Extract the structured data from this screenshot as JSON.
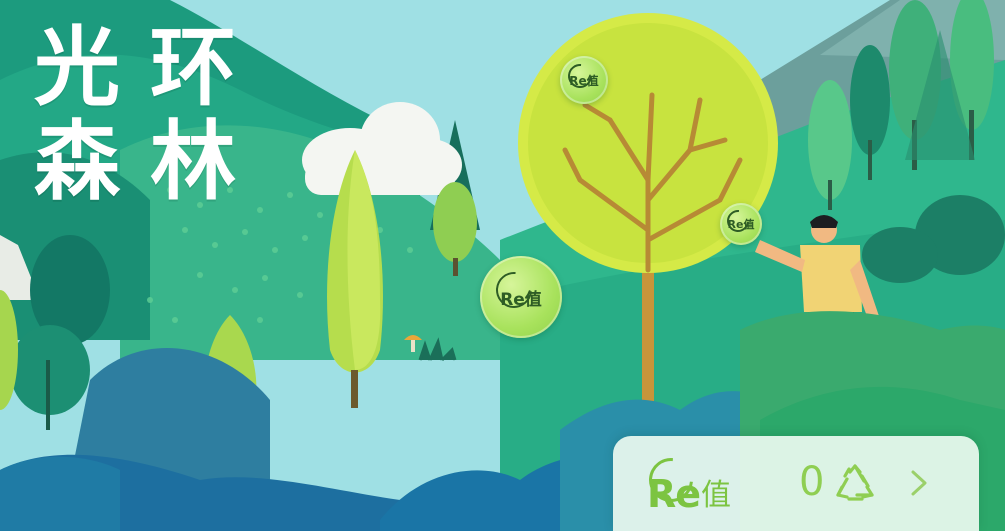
{
  "title": {
    "char1": "光",
    "char2": "环",
    "char3": "森",
    "char4": "林"
  },
  "bubbles": [
    {
      "label": "Re值"
    },
    {
      "label": "Re值"
    },
    {
      "label": "Re值"
    }
  ],
  "panel": {
    "re_text": "Re",
    "zhi_text": "值",
    "count": "0"
  },
  "icons": {
    "recycle": "recycle-icon",
    "chevron": "chevron-right-icon",
    "re_logo": "re-value-icon"
  },
  "colors": {
    "accent": "#7cc441",
    "bubble": "#b6e866",
    "grass": "#2fb99a",
    "panel_bg": "#ecfaf0"
  }
}
